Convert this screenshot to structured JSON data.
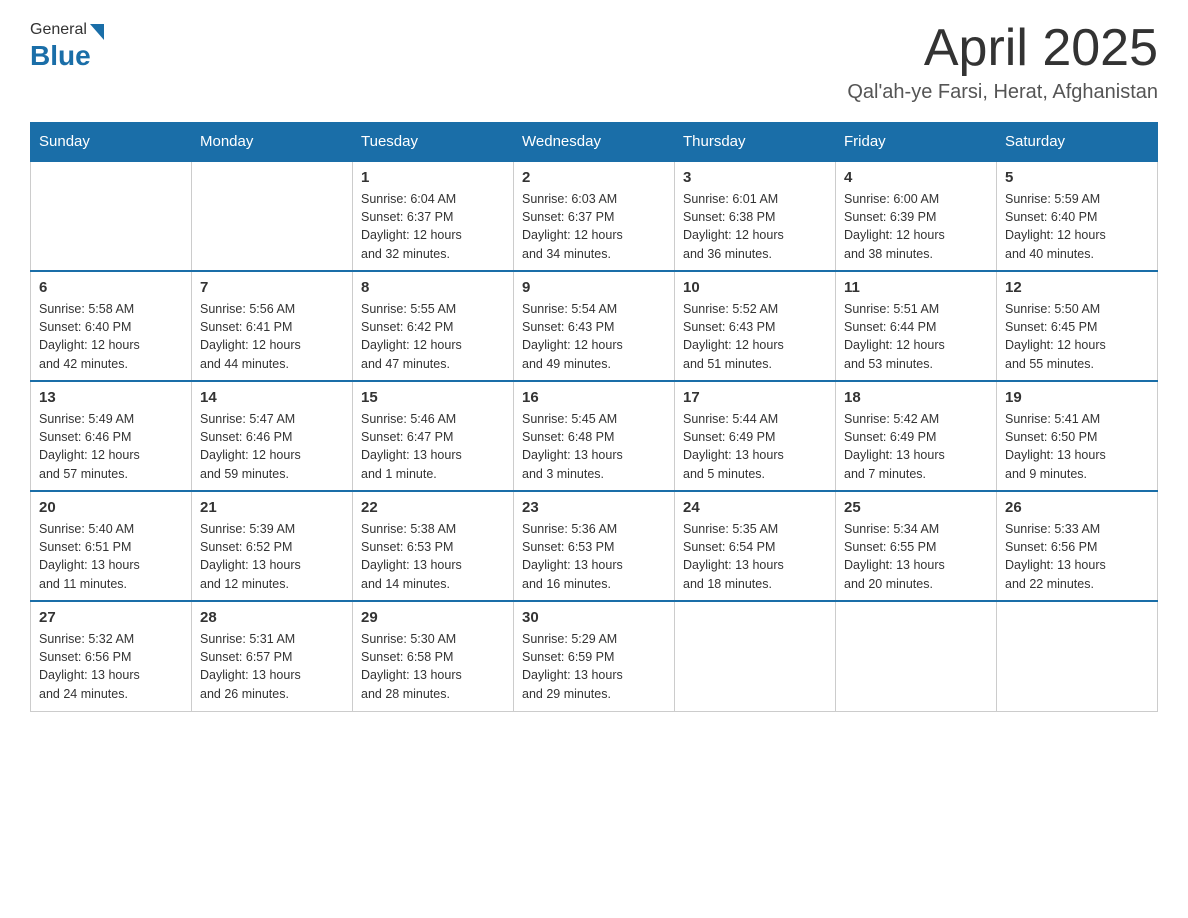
{
  "header": {
    "logo_general": "General",
    "logo_blue": "Blue",
    "title": "April 2025",
    "location": "Qal'ah-ye Farsi, Herat, Afghanistan"
  },
  "calendar": {
    "days_of_week": [
      "Sunday",
      "Monday",
      "Tuesday",
      "Wednesday",
      "Thursday",
      "Friday",
      "Saturday"
    ],
    "weeks": [
      [
        {
          "day": "",
          "info": ""
        },
        {
          "day": "",
          "info": ""
        },
        {
          "day": "1",
          "info": "Sunrise: 6:04 AM\nSunset: 6:37 PM\nDaylight: 12 hours\nand 32 minutes."
        },
        {
          "day": "2",
          "info": "Sunrise: 6:03 AM\nSunset: 6:37 PM\nDaylight: 12 hours\nand 34 minutes."
        },
        {
          "day": "3",
          "info": "Sunrise: 6:01 AM\nSunset: 6:38 PM\nDaylight: 12 hours\nand 36 minutes."
        },
        {
          "day": "4",
          "info": "Sunrise: 6:00 AM\nSunset: 6:39 PM\nDaylight: 12 hours\nand 38 minutes."
        },
        {
          "day": "5",
          "info": "Sunrise: 5:59 AM\nSunset: 6:40 PM\nDaylight: 12 hours\nand 40 minutes."
        }
      ],
      [
        {
          "day": "6",
          "info": "Sunrise: 5:58 AM\nSunset: 6:40 PM\nDaylight: 12 hours\nand 42 minutes."
        },
        {
          "day": "7",
          "info": "Sunrise: 5:56 AM\nSunset: 6:41 PM\nDaylight: 12 hours\nand 44 minutes."
        },
        {
          "day": "8",
          "info": "Sunrise: 5:55 AM\nSunset: 6:42 PM\nDaylight: 12 hours\nand 47 minutes."
        },
        {
          "day": "9",
          "info": "Sunrise: 5:54 AM\nSunset: 6:43 PM\nDaylight: 12 hours\nand 49 minutes."
        },
        {
          "day": "10",
          "info": "Sunrise: 5:52 AM\nSunset: 6:43 PM\nDaylight: 12 hours\nand 51 minutes."
        },
        {
          "day": "11",
          "info": "Sunrise: 5:51 AM\nSunset: 6:44 PM\nDaylight: 12 hours\nand 53 minutes."
        },
        {
          "day": "12",
          "info": "Sunrise: 5:50 AM\nSunset: 6:45 PM\nDaylight: 12 hours\nand 55 minutes."
        }
      ],
      [
        {
          "day": "13",
          "info": "Sunrise: 5:49 AM\nSunset: 6:46 PM\nDaylight: 12 hours\nand 57 minutes."
        },
        {
          "day": "14",
          "info": "Sunrise: 5:47 AM\nSunset: 6:46 PM\nDaylight: 12 hours\nand 59 minutes."
        },
        {
          "day": "15",
          "info": "Sunrise: 5:46 AM\nSunset: 6:47 PM\nDaylight: 13 hours\nand 1 minute."
        },
        {
          "day": "16",
          "info": "Sunrise: 5:45 AM\nSunset: 6:48 PM\nDaylight: 13 hours\nand 3 minutes."
        },
        {
          "day": "17",
          "info": "Sunrise: 5:44 AM\nSunset: 6:49 PM\nDaylight: 13 hours\nand 5 minutes."
        },
        {
          "day": "18",
          "info": "Sunrise: 5:42 AM\nSunset: 6:49 PM\nDaylight: 13 hours\nand 7 minutes."
        },
        {
          "day": "19",
          "info": "Sunrise: 5:41 AM\nSunset: 6:50 PM\nDaylight: 13 hours\nand 9 minutes."
        }
      ],
      [
        {
          "day": "20",
          "info": "Sunrise: 5:40 AM\nSunset: 6:51 PM\nDaylight: 13 hours\nand 11 minutes."
        },
        {
          "day": "21",
          "info": "Sunrise: 5:39 AM\nSunset: 6:52 PM\nDaylight: 13 hours\nand 12 minutes."
        },
        {
          "day": "22",
          "info": "Sunrise: 5:38 AM\nSunset: 6:53 PM\nDaylight: 13 hours\nand 14 minutes."
        },
        {
          "day": "23",
          "info": "Sunrise: 5:36 AM\nSunset: 6:53 PM\nDaylight: 13 hours\nand 16 minutes."
        },
        {
          "day": "24",
          "info": "Sunrise: 5:35 AM\nSunset: 6:54 PM\nDaylight: 13 hours\nand 18 minutes."
        },
        {
          "day": "25",
          "info": "Sunrise: 5:34 AM\nSunset: 6:55 PM\nDaylight: 13 hours\nand 20 minutes."
        },
        {
          "day": "26",
          "info": "Sunrise: 5:33 AM\nSunset: 6:56 PM\nDaylight: 13 hours\nand 22 minutes."
        }
      ],
      [
        {
          "day": "27",
          "info": "Sunrise: 5:32 AM\nSunset: 6:56 PM\nDaylight: 13 hours\nand 24 minutes."
        },
        {
          "day": "28",
          "info": "Sunrise: 5:31 AM\nSunset: 6:57 PM\nDaylight: 13 hours\nand 26 minutes."
        },
        {
          "day": "29",
          "info": "Sunrise: 5:30 AM\nSunset: 6:58 PM\nDaylight: 13 hours\nand 28 minutes."
        },
        {
          "day": "30",
          "info": "Sunrise: 5:29 AM\nSunset: 6:59 PM\nDaylight: 13 hours\nand 29 minutes."
        },
        {
          "day": "",
          "info": ""
        },
        {
          "day": "",
          "info": ""
        },
        {
          "day": "",
          "info": ""
        }
      ]
    ]
  }
}
